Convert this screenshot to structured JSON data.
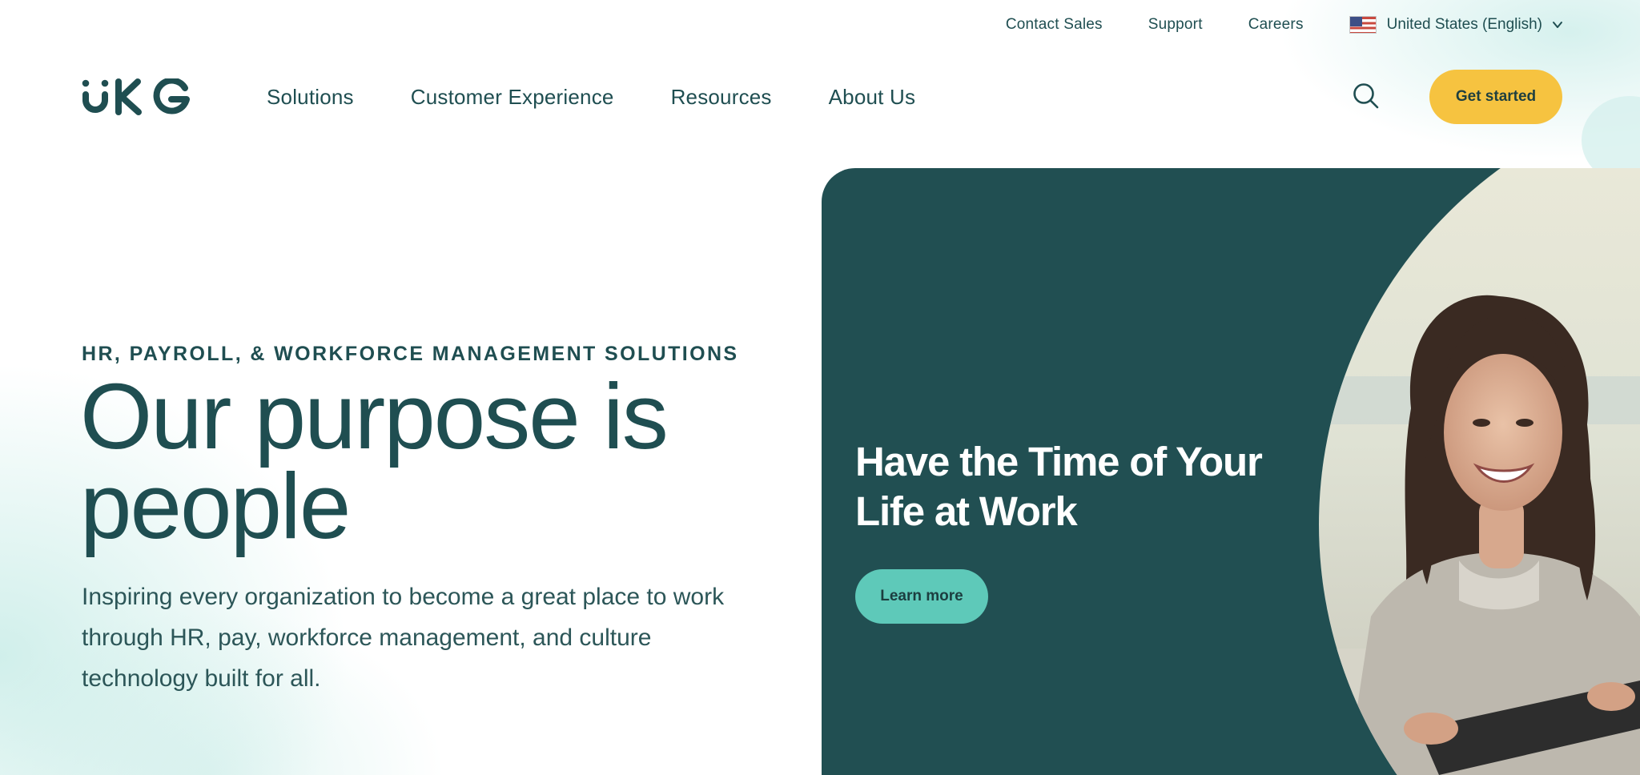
{
  "utility": {
    "contact_sales": "Contact Sales",
    "support": "Support",
    "careers": "Careers",
    "locale": "United States (English)"
  },
  "brand": {
    "logo_text": "UKG"
  },
  "nav": {
    "items": [
      {
        "label": "Solutions"
      },
      {
        "label": "Customer Experience"
      },
      {
        "label": "Resources"
      },
      {
        "label": "About Us"
      }
    ],
    "cta_label": "Get started"
  },
  "hero": {
    "eyebrow": "HR, PAYROLL, & WORKFORCE MANAGEMENT SOLUTIONS",
    "title": "Our purpose is people",
    "description": "Inspiring every organization to become a great place to work through HR, pay, workforce management, and culture technology built for all."
  },
  "promo": {
    "title": "Have the Time of Your Life at Work",
    "button_label": "Learn more"
  },
  "colors": {
    "brand_dark": "#1f4e51",
    "promo_bg": "#214f52",
    "cta_yellow": "#f6c340",
    "button_teal": "#5ec9b9"
  },
  "icons": {
    "search": "search-icon",
    "flag": "us-flag-icon",
    "chevron": "chevron-down-icon"
  }
}
